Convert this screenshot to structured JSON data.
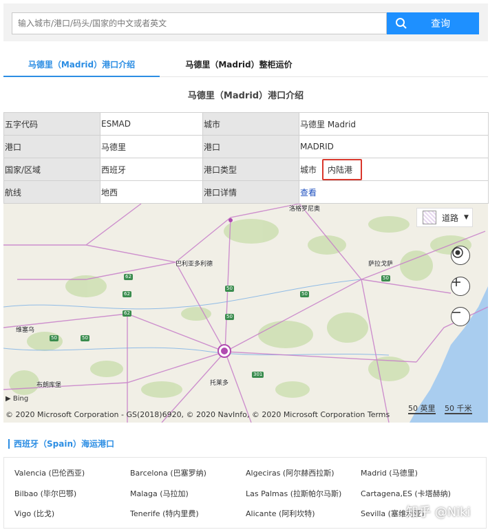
{
  "search": {
    "placeholder": "输入城市/港口/码头/国家的中文或者英文",
    "button_label": "查询"
  },
  "tabs": [
    {
      "label": "马德里（Madrid）港口介绍",
      "active": true
    },
    {
      "label": "马德里（Madrid）整柜运价",
      "active": false
    }
  ],
  "section_title": "马德里（Madrid）港口介绍",
  "info_table": {
    "rows": [
      {
        "k1": "五字代码",
        "v1": "ESMAD",
        "k2": "城市",
        "v2": "马德里 Madrid"
      },
      {
        "k1": "港口",
        "v1": "马德里",
        "k2": "港口",
        "v2": "MADRID"
      },
      {
        "k1": "国家/区域",
        "v1": "西班牙",
        "k2": "港口类型",
        "v2_prefix": "城市",
        "v2_highlight": "内陆港"
      },
      {
        "k1": "航线",
        "v1": "地西",
        "k2": "港口详情",
        "v2_link": "查看"
      }
    ]
  },
  "map": {
    "layer_label": "道路",
    "city_labels": [
      "洛格罗尼奥",
      "巴利亚多利德",
      "萨拉戈萨",
      "维塞乌",
      "布朗库堡",
      "托莱多"
    ],
    "road_shields": [
      "62",
      "62",
      "62",
      "50",
      "50",
      "50",
      "50",
      "50",
      "50",
      "301"
    ],
    "bing_label": "Bing",
    "copyright": "© 2020 Microsoft Corporation - GS(2018)6920, © 2020 NavInfo, © 2020 Microsoft Corporation Terms",
    "scale_miles": "50 英里",
    "scale_km": "50 千米",
    "locate_icon": "locate-icon",
    "zoom_in_icon": "plus-icon",
    "zoom_out_icon": "minus-icon"
  },
  "ports": {
    "title": "西班牙（Spain）海运港口",
    "items": [
      "Valencia (巴伦西亚)",
      "Barcelona (巴塞罗纳)",
      "Algeciras (阿尔赫西拉斯)",
      "Madrid (马德里)",
      "Bilbao (毕尔巴鄂)",
      "Malaga (马拉加)",
      "Las Palmas (拉斯帕尔马斯)",
      "Cartagena,ES (卡塔赫纳)",
      "Vigo (比戈)",
      "Tenerife (特内里费)",
      "Alicante (阿利坎特)",
      "Sevilla (塞维利亚)"
    ]
  },
  "watermark": "知乎 @Niki",
  "colors": {
    "accent": "#2b8de3",
    "button": "#1e90ff",
    "highlight_border": "#d9362b",
    "link": "#1d4fbf"
  }
}
